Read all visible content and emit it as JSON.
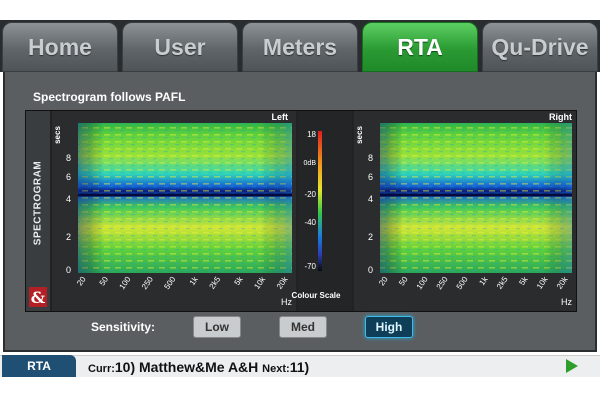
{
  "tabs": [
    {
      "label": "Home",
      "active": false
    },
    {
      "label": "User",
      "active": false
    },
    {
      "label": "Meters",
      "active": false
    },
    {
      "label": "RTA",
      "active": true
    },
    {
      "label": "Qu-Drive",
      "active": false
    }
  ],
  "panel": {
    "title": "Spectrogram follows PAFL",
    "side_label": "SPECTROGRAM",
    "logo_text": "&"
  },
  "spectrograms": {
    "left": {
      "title": "Left",
      "y_unit": "secs",
      "y_ticks": [
        "8",
        "6",
        "4",
        "2",
        "0"
      ],
      "x_ticks": [
        "20",
        "50",
        "100",
        "250",
        "500",
        "1k",
        "2k5",
        "5k",
        "10k",
        "20k"
      ],
      "x_unit": "Hz"
    },
    "right": {
      "title": "Right",
      "y_unit": "secs",
      "y_ticks": [
        "8",
        "6",
        "4",
        "2",
        "0"
      ],
      "x_ticks": [
        "20",
        "50",
        "100",
        "250",
        "500",
        "1k",
        "2k5",
        "5k",
        "10k",
        "20k"
      ],
      "x_unit": "Hz"
    }
  },
  "colour_scale": {
    "ticks": [
      "18",
      "0dB",
      "-20",
      "-40",
      "-70"
    ],
    "label": "Colour Scale"
  },
  "sensitivity": {
    "label": "Sensitivity:",
    "options": [
      "Low",
      "Med",
      "High"
    ],
    "selected": "High"
  },
  "status": {
    "mode": "RTA",
    "curr_label": "Curr:",
    "curr_value": "10) Matthew&Me A&H",
    "next_label": "Next:",
    "next_value": "11)"
  },
  "colors": {
    "active_tab": "#2a9a33",
    "high_button": "#0f3f58",
    "status_mode": "#1f4f73",
    "play": "#2e9e2a"
  }
}
